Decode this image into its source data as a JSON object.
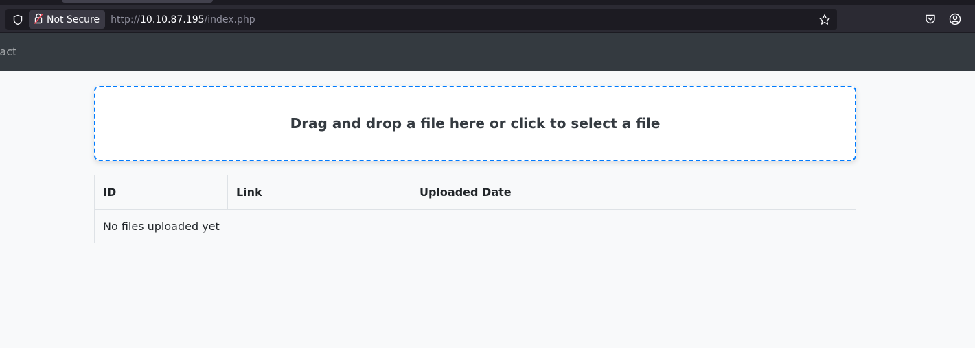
{
  "browser": {
    "security_label": "Not Secure",
    "url_prefix": "http://",
    "url_host": "10.10.87.195",
    "url_path": "/index.php",
    "icons": [
      "shield-icon",
      "lock-insecure-icon",
      "star-icon",
      "pocket-icon",
      "account-icon"
    ]
  },
  "nav": {
    "partial_link": "ntact"
  },
  "dropzone": {
    "text": "Drag and drop a file here or click to select a file",
    "border_color": "#007bff"
  },
  "table": {
    "headers": [
      "ID",
      "Link",
      "Uploaded Date"
    ],
    "empty_message": "No files uploaded yet"
  },
  "colors": {
    "navbar": "#343a40",
    "page_bg": "#f8f9fa",
    "browser_chrome": "#2b2a33"
  }
}
